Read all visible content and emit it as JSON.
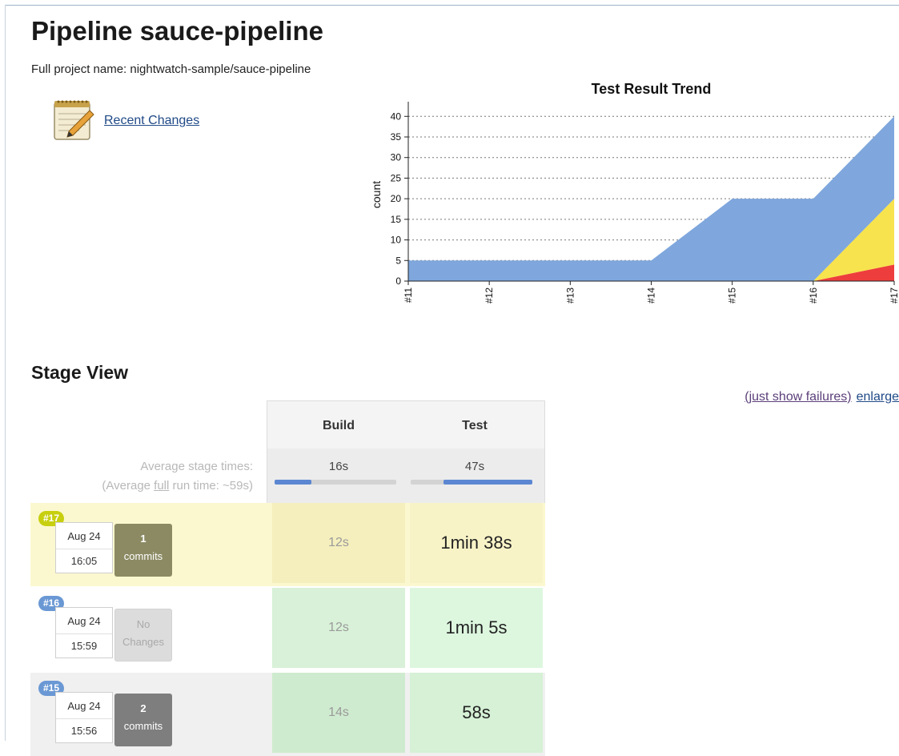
{
  "header": {
    "title": "Pipeline sauce-pipeline",
    "full_project_name": "Full project name: nightwatch-sample/sauce-pipeline"
  },
  "links": {
    "recent_changes": "Recent Changes",
    "just_show_failures": "(just show failures)",
    "enlarge": "enlarge"
  },
  "chart_data": {
    "type": "area",
    "title": "Test Result Trend",
    "ylabel": "count",
    "xlabel": "",
    "categories": [
      "#11",
      "#12",
      "#13",
      "#14",
      "#15",
      "#16",
      "#17"
    ],
    "yticks": [
      0,
      5,
      10,
      15,
      20,
      25,
      30,
      35,
      40
    ],
    "ylim": [
      0,
      42
    ],
    "grid": true,
    "stacked": true,
    "series": [
      {
        "color": "#ee3d3d",
        "values": [
          0,
          0,
          0,
          0,
          0,
          0,
          4
        ]
      },
      {
        "color": "#f7e34d",
        "values": [
          0,
          0,
          0,
          0,
          0,
          0,
          16
        ]
      },
      {
        "color": "#7fa7dd",
        "values": [
          5,
          5,
          5,
          5,
          20,
          20,
          20
        ]
      }
    ]
  },
  "stage_view": {
    "title": "Stage View",
    "columns": [
      "Build",
      "Test"
    ],
    "average_label": "Average stage times:",
    "full_run_prefix": "(Average ",
    "full_run_word": "full",
    "full_run_suffix": " run time: ~59s)",
    "average_times": [
      "16s",
      "47s"
    ],
    "average_bars": [
      {
        "start": 0.0,
        "fill": 0.3
      },
      {
        "start": 0.27,
        "fill": 0.73
      }
    ],
    "runs": [
      {
        "badge": "#17",
        "badge_color": "#c7cf0e",
        "row_color": "#fbf8cf",
        "date": "Aug 24",
        "time": "16:05",
        "commits_num": "1",
        "commits_label": "commits",
        "commits_color": "#8b8a63",
        "no_changes": false,
        "build": "12s",
        "build_color": "#f5efbd",
        "test": "1min 38s",
        "test_color": "#f8f3c7"
      },
      {
        "badge": "#16",
        "badge_color": "#6a98d4",
        "row_color": "#ffffff",
        "date": "Aug 24",
        "time": "15:59",
        "commits_num": "No",
        "commits_label": "Changes",
        "commits_color": "#dcdcdc",
        "no_changes": true,
        "build": "12s",
        "build_color": "#d8f1d8",
        "test": "1min 5s",
        "test_color": "#ddf7df"
      },
      {
        "badge": "#15",
        "badge_color": "#6a98d4",
        "row_color": "#f0f0f0",
        "date": "Aug 24",
        "time": "15:56",
        "commits_num": "2",
        "commits_label": "commits",
        "commits_color": "#7e7e7e",
        "no_changes": false,
        "build": "14s",
        "build_color": "#cfebcf",
        "test": "58s",
        "test_color": "#d6f1d6"
      }
    ]
  }
}
